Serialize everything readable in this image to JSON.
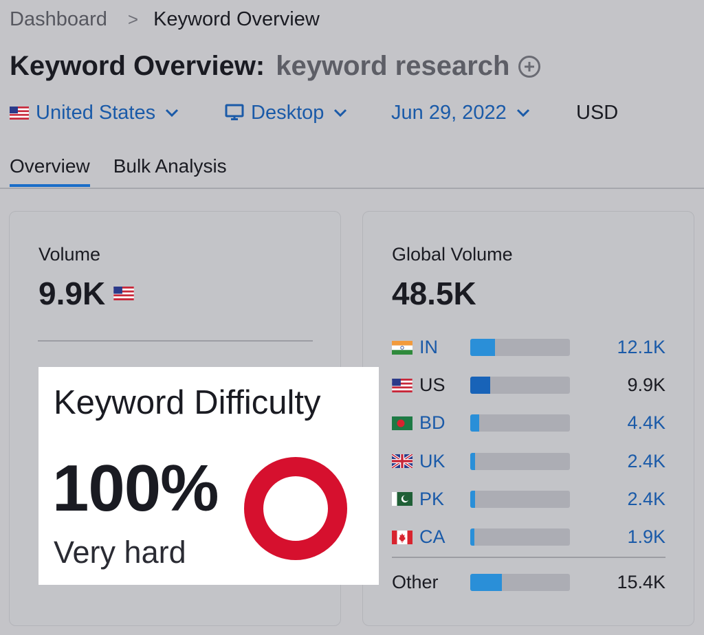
{
  "breadcrumb": {
    "home": "Dashboard",
    "separator": ">",
    "current": "Keyword Overview"
  },
  "title": {
    "prefix": "Keyword Overview:",
    "keyword": "keyword research",
    "add_icon": "plus-circle-icon"
  },
  "filters": {
    "country": "United States",
    "device": "Desktop",
    "date": "Jun 29, 2022",
    "currency": "USD"
  },
  "tabs": [
    {
      "label": "Overview",
      "active": true
    },
    {
      "label": "Bulk Analysis",
      "active": false
    }
  ],
  "volume": {
    "label": "Volume",
    "value": "9.9K",
    "flag": "US"
  },
  "keyword_difficulty": {
    "label": "Keyword Difficulty",
    "value": "100%",
    "level": "Very hard",
    "percent": 100,
    "color": "#d6102e"
  },
  "global_volume": {
    "label": "Global Volume",
    "value": "48.5K",
    "countries": [
      {
        "code": "IN",
        "value": "12.1K",
        "share": 0.25
      },
      {
        "code": "US",
        "value": "9.9K",
        "share": 0.2
      },
      {
        "code": "BD",
        "value": "4.4K",
        "share": 0.09
      },
      {
        "code": "UK",
        "value": "2.4K",
        "share": 0.05
      },
      {
        "code": "PK",
        "value": "2.4K",
        "share": 0.05
      },
      {
        "code": "CA",
        "value": "1.9K",
        "share": 0.04
      }
    ],
    "other": {
      "label": "Other",
      "value": "15.4K",
      "share": 0.32
    }
  },
  "colors": {
    "link": "#1a5aa8",
    "bar_fill": "#2a8fd8",
    "bar_fill_us": "#1863b8",
    "tab_active": "#1a6dc8"
  }
}
